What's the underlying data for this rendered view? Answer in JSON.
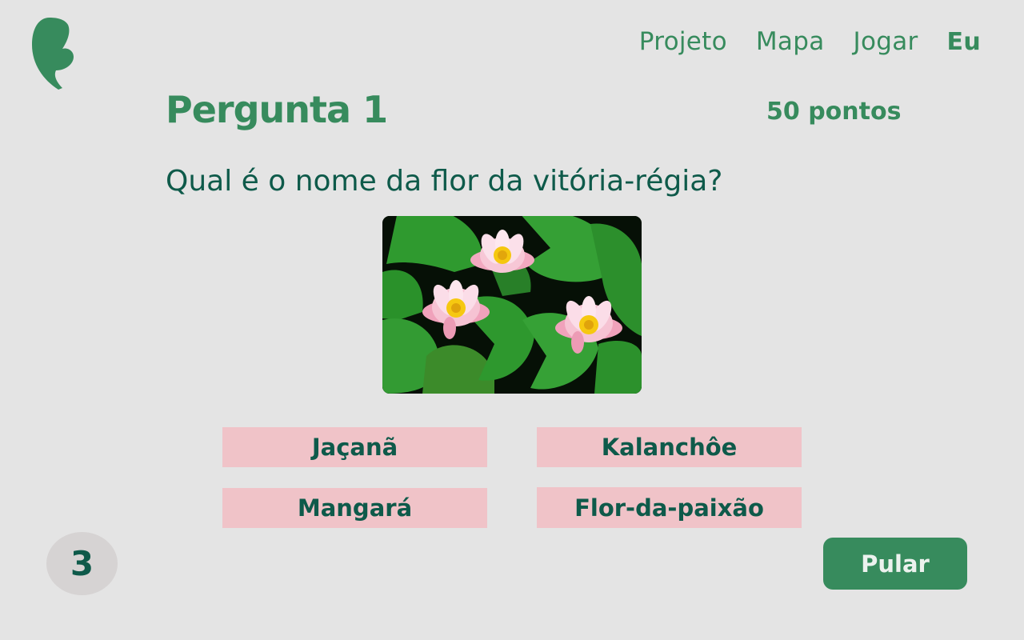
{
  "nav": {
    "items": [
      {
        "label": "Projeto"
      },
      {
        "label": "Mapa"
      },
      {
        "label": "Jogar"
      },
      {
        "label": "Eu"
      }
    ],
    "active": "Eu"
  },
  "question": {
    "title": "Pergunta 1",
    "points": "50 pontos",
    "text": "Qual é o nome da flor da vitória-régia?",
    "image_icon": "water-lily-photo"
  },
  "answers": [
    {
      "label": "Jaçanã"
    },
    {
      "label": "Kalanchôe"
    },
    {
      "label": "Mangará"
    },
    {
      "label": "Flor-da-paixão"
    }
  ],
  "counter": "3",
  "skip_label": "Pular",
  "colors": {
    "background": "#e4e4e4",
    "brand_green": "#378b5d",
    "text_dark_green": "#0e5a4a",
    "answer_pink": "#f0c3c8",
    "counter_gray": "#d6d3d3"
  }
}
